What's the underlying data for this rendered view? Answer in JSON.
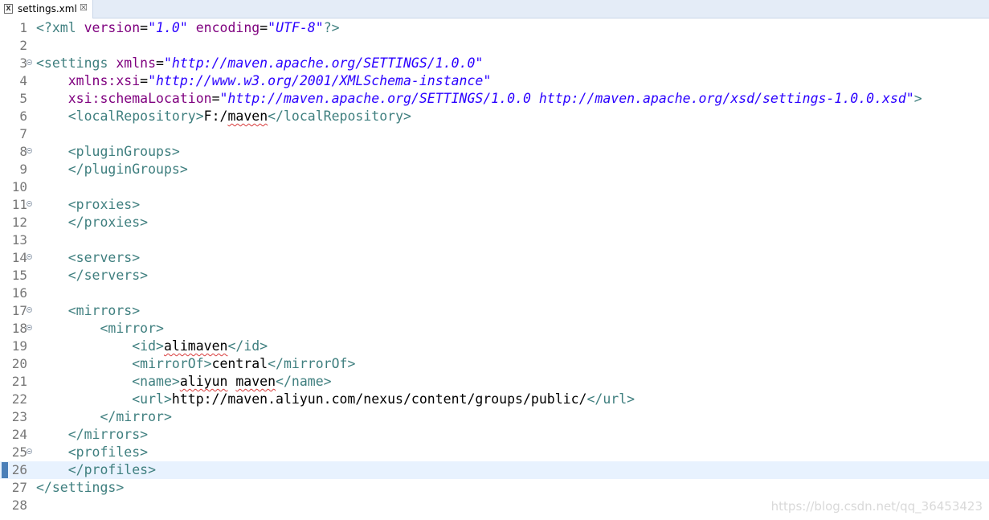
{
  "tab": {
    "title": "settings.xml",
    "icon": "xml-file-icon",
    "close_glyph": "☒"
  },
  "lines": [
    {
      "n": "1",
      "fold": false,
      "tokens": [
        {
          "c": "t",
          "s": "<?"
        },
        {
          "c": "t",
          "s": "xml"
        },
        {
          "c": "x",
          "s": " "
        },
        {
          "c": "a",
          "s": "version"
        },
        {
          "c": "x",
          "s": "="
        },
        {
          "c": "v",
          "s": "\"1.0\""
        },
        {
          "c": "x",
          "s": " "
        },
        {
          "c": "a",
          "s": "encoding"
        },
        {
          "c": "x",
          "s": "="
        },
        {
          "c": "v",
          "s": "\"UTF-8\""
        },
        {
          "c": "t",
          "s": "?>"
        }
      ]
    },
    {
      "n": "2",
      "fold": false,
      "tokens": []
    },
    {
      "n": "3",
      "fold": true,
      "tokens": [
        {
          "c": "t",
          "s": "<settings"
        },
        {
          "c": "x",
          "s": " "
        },
        {
          "c": "a",
          "s": "xmlns"
        },
        {
          "c": "x",
          "s": "="
        },
        {
          "c": "v",
          "s": "\"http://maven.apache.org/SETTINGS/1.0.0\""
        }
      ]
    },
    {
      "n": "4",
      "fold": false,
      "tokens": [
        {
          "c": "x",
          "s": "    "
        },
        {
          "c": "a",
          "s": "xmlns:xsi"
        },
        {
          "c": "x",
          "s": "="
        },
        {
          "c": "v",
          "s": "\"http://www.w3.org/2001/XMLSchema-instance\""
        }
      ]
    },
    {
      "n": "5",
      "fold": false,
      "tokens": [
        {
          "c": "x",
          "s": "    "
        },
        {
          "c": "a",
          "s": "xsi:schemaLocation"
        },
        {
          "c": "x",
          "s": "="
        },
        {
          "c": "v",
          "s": "\"http://maven.apache.org/SETTINGS/1.0.0 http://maven.apache.org/xsd/settings-1.0.0.xsd\""
        },
        {
          "c": "t",
          "s": ">"
        }
      ]
    },
    {
      "n": "6",
      "fold": false,
      "tokens": [
        {
          "c": "x",
          "s": "    "
        },
        {
          "c": "t",
          "s": "<localRepository>"
        },
        {
          "c": "x",
          "s": "F:/"
        },
        {
          "c": "sq",
          "s": "maven"
        },
        {
          "c": "t",
          "s": "</localRepository>"
        }
      ]
    },
    {
      "n": "7",
      "fold": false,
      "tokens": []
    },
    {
      "n": "8",
      "fold": true,
      "tokens": [
        {
          "c": "x",
          "s": "    "
        },
        {
          "c": "t",
          "s": "<pluginGroups>"
        }
      ]
    },
    {
      "n": "9",
      "fold": false,
      "tokens": [
        {
          "c": "x",
          "s": "    "
        },
        {
          "c": "t",
          "s": "</pluginGroups>"
        }
      ]
    },
    {
      "n": "10",
      "fold": false,
      "tokens": []
    },
    {
      "n": "11",
      "fold": true,
      "tokens": [
        {
          "c": "x",
          "s": "    "
        },
        {
          "c": "t",
          "s": "<proxies>"
        }
      ]
    },
    {
      "n": "12",
      "fold": false,
      "tokens": [
        {
          "c": "x",
          "s": "    "
        },
        {
          "c": "t",
          "s": "</proxies>"
        }
      ]
    },
    {
      "n": "13",
      "fold": false,
      "tokens": []
    },
    {
      "n": "14",
      "fold": true,
      "tokens": [
        {
          "c": "x",
          "s": "    "
        },
        {
          "c": "t",
          "s": "<servers>"
        }
      ]
    },
    {
      "n": "15",
      "fold": false,
      "tokens": [
        {
          "c": "x",
          "s": "    "
        },
        {
          "c": "t",
          "s": "</servers>"
        }
      ]
    },
    {
      "n": "16",
      "fold": false,
      "tokens": []
    },
    {
      "n": "17",
      "fold": true,
      "tokens": [
        {
          "c": "x",
          "s": "    "
        },
        {
          "c": "t",
          "s": "<mirrors>"
        }
      ]
    },
    {
      "n": "18",
      "fold": true,
      "tokens": [
        {
          "c": "x",
          "s": "        "
        },
        {
          "c": "t",
          "s": "<mirror>"
        }
      ]
    },
    {
      "n": "19",
      "fold": false,
      "tokens": [
        {
          "c": "x",
          "s": "            "
        },
        {
          "c": "t",
          "s": "<id>"
        },
        {
          "c": "sq",
          "s": "alimaven"
        },
        {
          "c": "t",
          "s": "</id>"
        }
      ]
    },
    {
      "n": "20",
      "fold": false,
      "tokens": [
        {
          "c": "x",
          "s": "            "
        },
        {
          "c": "t",
          "s": "<mirrorOf>"
        },
        {
          "c": "x",
          "s": "central"
        },
        {
          "c": "t",
          "s": "</mirrorOf>"
        }
      ]
    },
    {
      "n": "21",
      "fold": false,
      "tokens": [
        {
          "c": "x",
          "s": "            "
        },
        {
          "c": "t",
          "s": "<name>"
        },
        {
          "c": "sq",
          "s": "aliyun"
        },
        {
          "c": "x",
          "s": " "
        },
        {
          "c": "sq",
          "s": "maven"
        },
        {
          "c": "t",
          "s": "</name>"
        }
      ]
    },
    {
      "n": "22",
      "fold": false,
      "tokens": [
        {
          "c": "x",
          "s": "            "
        },
        {
          "c": "t",
          "s": "<url>"
        },
        {
          "c": "x",
          "s": "http://maven.aliyun.com/nexus/content/groups/public/"
        },
        {
          "c": "t",
          "s": "</url>"
        }
      ]
    },
    {
      "n": "23",
      "fold": false,
      "tokens": [
        {
          "c": "x",
          "s": "        "
        },
        {
          "c": "t",
          "s": "</mirror>"
        }
      ]
    },
    {
      "n": "24",
      "fold": false,
      "tokens": [
        {
          "c": "x",
          "s": "    "
        },
        {
          "c": "t",
          "s": "</mirrors>"
        }
      ]
    },
    {
      "n": "25",
      "fold": true,
      "tokens": [
        {
          "c": "x",
          "s": "    "
        },
        {
          "c": "t",
          "s": "<profiles>"
        }
      ]
    },
    {
      "n": "26",
      "fold": false,
      "current": true,
      "tokens": [
        {
          "c": "x",
          "s": "    "
        },
        {
          "c": "t",
          "s": "</profiles>"
        }
      ]
    },
    {
      "n": "27",
      "fold": false,
      "tokens": [
        {
          "c": "t",
          "s": "</settings>"
        }
      ]
    },
    {
      "n": "28",
      "fold": false,
      "tokens": []
    }
  ],
  "watermark": "https://blog.csdn.net/qq_36453423",
  "colors": {
    "tag": "#3f7f7f",
    "attribute": "#7f007f",
    "value": "#2a00ff",
    "current_line": "#e8f2fe"
  }
}
